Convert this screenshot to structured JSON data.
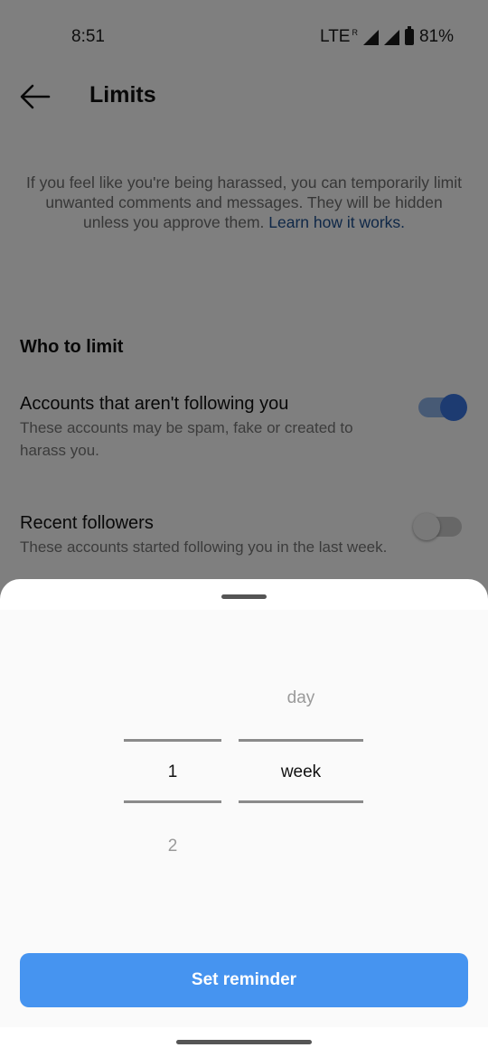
{
  "status_bar": {
    "time": "8:51",
    "network": "LTE",
    "roaming": "R",
    "battery": "81%"
  },
  "header": {
    "title": "Limits",
    "back_icon": "back-arrow-icon"
  },
  "description": {
    "text": "If you feel like you're being harassed, you can temporarily limit unwanted comments and messages. They will be hidden unless you approve them. ",
    "link": "Learn how it works."
  },
  "section": {
    "title": "Who to limit",
    "options": [
      {
        "title": "Accounts that aren't following you",
        "description": "These accounts may be spam, fake or created to harass you.",
        "enabled": true
      },
      {
        "title": "Recent followers",
        "description": "These accounts started following you in the last week.",
        "enabled": false
      }
    ]
  },
  "picker": {
    "number_column": {
      "above": "",
      "selected": "1",
      "below": "2"
    },
    "unit_column": {
      "above": "day",
      "selected": "week",
      "below": ""
    }
  },
  "button": {
    "label": "Set reminder"
  },
  "colors": {
    "accent": "#4694f0",
    "toggle_on": "#3a77e3",
    "link": "#1d4f8f"
  }
}
